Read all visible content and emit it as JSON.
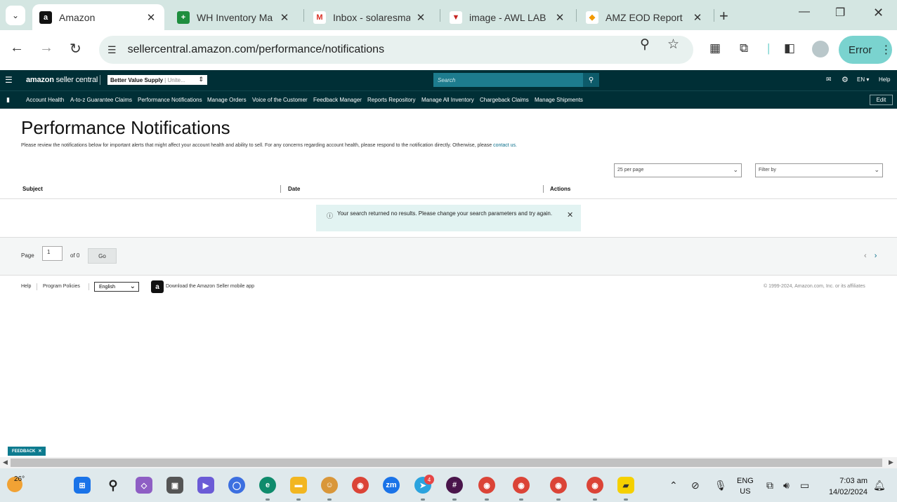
{
  "browser": {
    "tabs": [
      {
        "title": "Amazon",
        "active": true,
        "favicon": "amazon-icon",
        "color": "#111111",
        "glyph": "a"
      },
      {
        "title": "WH Inventory Ma",
        "active": false,
        "favicon": "sheets-icon",
        "color": "#1e8e3e",
        "glyph": "+"
      },
      {
        "title": "Inbox - solaresma",
        "active": false,
        "favicon": "gmail-icon",
        "color": "#d93025",
        "glyph": "M"
      },
      {
        "title": "image - AWL LAB",
        "active": false,
        "favicon": "awl-icon",
        "color": "#c5221f",
        "glyph": "▼"
      },
      {
        "title": "AMZ EOD Report",
        "active": false,
        "favicon": "clickup-icon",
        "color": "#f29900",
        "glyph": "◆"
      }
    ],
    "url": "sellercentral.amazon.com/performance/notifications",
    "profile_status": "Error"
  },
  "seller_central": {
    "logo_bold": "amazon",
    "logo_rest": " seller central",
    "store_name": "Better Value Supply",
    "store_region": "| Unite...",
    "search_placeholder": "Search",
    "lang": "EN",
    "help": "Help",
    "nav": [
      "Account Health",
      "A-to-z Guarantee Claims",
      "Performance Notifications",
      "Manage Orders",
      "Voice of the Customer",
      "Feedback Manager",
      "Reports Repository",
      "Manage All Inventory",
      "Chargeback Claims",
      "Manage Shipments"
    ],
    "edit": "Edit"
  },
  "page": {
    "title": "Performance Notifications",
    "desc": "Please review the notifications below for important alerts that might affect your account health and ability to sell. For any concerns regarding account health, please respond to the notification directly. Otherwise, please ",
    "desc_link": "contact us.",
    "per_page": "25 per page",
    "filter": "Filter by",
    "columns": [
      "Subject",
      "Date",
      "Actions"
    ],
    "alert": "Your search returned no results. Please change your search parameters and try again.",
    "pager": {
      "page_label": "Page",
      "page_value": "1",
      "of": "of 0",
      "go": "Go"
    }
  },
  "footer": {
    "help": "Help",
    "policies": "Program Policies",
    "language": "English",
    "app": "Download the Amazon Seller mobile app",
    "copyright": "© 1999-2024, Amazon.com, Inc. or its affiliates"
  },
  "feedback": "FEEDBACK",
  "taskbar": {
    "temp": "26°",
    "lang1": "ENG",
    "lang2": "US",
    "time": "7:03 am",
    "date": "14/02/2024",
    "telegram_badge": "4"
  }
}
